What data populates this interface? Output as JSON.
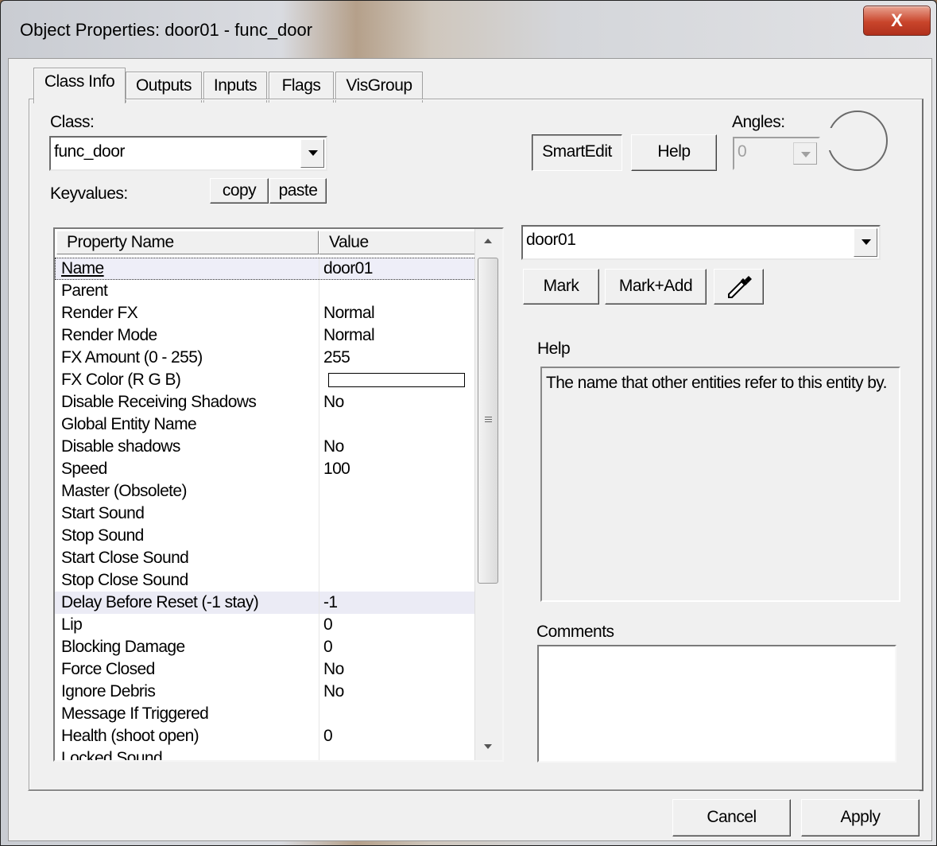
{
  "window": {
    "title": "Object Properties: door01 - func_door",
    "close_glyph": "X"
  },
  "tabs": [
    {
      "label": "Class Info",
      "active": true
    },
    {
      "label": "Outputs"
    },
    {
      "label": "Inputs"
    },
    {
      "label": "Flags"
    },
    {
      "label": "VisGroup"
    }
  ],
  "class_info": {
    "class_label": "Class:",
    "class_value": "func_door",
    "keyvalues_label": "Keyvalues:",
    "copy_label": "copy",
    "paste_label": "paste",
    "smartedit_label": "SmartEdit",
    "help_button_label": "Help",
    "angles_label": "Angles:",
    "angles_value": "0"
  },
  "grid": {
    "col_name": "Property Name",
    "col_value": "Value",
    "rows": [
      {
        "name": "Name",
        "value": "door01"
      },
      {
        "name": "Parent",
        "value": ""
      },
      {
        "name": "Render FX",
        "value": "Normal"
      },
      {
        "name": "Render Mode",
        "value": "Normal"
      },
      {
        "name": "FX Amount (0 - 255)",
        "value": "255"
      },
      {
        "name": "FX Color (R G B)",
        "value": ""
      },
      {
        "name": "Disable Receiving Shadows",
        "value": "No"
      },
      {
        "name": "Global Entity Name",
        "value": ""
      },
      {
        "name": "Disable shadows",
        "value": "No"
      },
      {
        "name": "Speed",
        "value": "100"
      },
      {
        "name": "Master (Obsolete)",
        "value": ""
      },
      {
        "name": "Start Sound",
        "value": ""
      },
      {
        "name": "Stop Sound",
        "value": ""
      },
      {
        "name": "Start Close Sound",
        "value": ""
      },
      {
        "name": "Stop Close Sound",
        "value": ""
      },
      {
        "name": "Delay Before Reset (-1 stay)",
        "value": "-1"
      },
      {
        "name": "Lip",
        "value": "0"
      },
      {
        "name": "Blocking Damage",
        "value": "0"
      },
      {
        "name": "Force Closed",
        "value": "No"
      },
      {
        "name": "Ignore Debris",
        "value": "No"
      },
      {
        "name": "Message If Triggered",
        "value": ""
      },
      {
        "name": "Health (shoot open)",
        "value": "0"
      },
      {
        "name": "Locked Sound",
        "value": ""
      }
    ]
  },
  "editor": {
    "value_combo": "door01",
    "mark_label": "Mark",
    "mark_add_label": "Mark+Add",
    "help_label": "Help",
    "help_text": "The name that other entities refer to this entity by.",
    "comments_label": "Comments",
    "comments_value": ""
  },
  "footer": {
    "cancel_label": "Cancel",
    "apply_label": "Apply"
  }
}
